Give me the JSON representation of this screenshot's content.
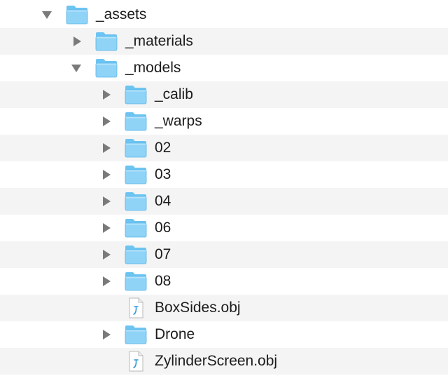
{
  "tree": {
    "items": [
      {
        "label": "_assets",
        "type": "folder",
        "state": "expanded",
        "depth": 0
      },
      {
        "label": "_materials",
        "type": "folder",
        "state": "collapsed",
        "depth": 1
      },
      {
        "label": "_models",
        "type": "folder",
        "state": "expanded",
        "depth": 1
      },
      {
        "label": "_calib",
        "type": "folder",
        "state": "collapsed",
        "depth": 2
      },
      {
        "label": "_warps",
        "type": "folder",
        "state": "collapsed",
        "depth": 2
      },
      {
        "label": "02",
        "type": "folder",
        "state": "collapsed",
        "depth": 2
      },
      {
        "label": "03",
        "type": "folder",
        "state": "collapsed",
        "depth": 2
      },
      {
        "label": "04",
        "type": "folder",
        "state": "collapsed",
        "depth": 2
      },
      {
        "label": "06",
        "type": "folder",
        "state": "collapsed",
        "depth": 2
      },
      {
        "label": "07",
        "type": "folder",
        "state": "collapsed",
        "depth": 2
      },
      {
        "label": "08",
        "type": "folder",
        "state": "collapsed",
        "depth": 2
      },
      {
        "label": "BoxSides.obj",
        "type": "file",
        "depth": 2
      },
      {
        "label": "Drone",
        "type": "folder",
        "state": "collapsed",
        "depth": 2
      },
      {
        "label": "ZylinderScreen.obj",
        "type": "file",
        "depth": 2
      }
    ]
  },
  "colors": {
    "folder_body": "#8fd3f7",
    "folder_tab": "#6cc4f2",
    "folder_edge": "#5bb5e6",
    "stripe": "#f4f4f4",
    "disclosure": "#7a7a7a",
    "text": "#1c1c1c"
  },
  "icons": {
    "folder": "folder-icon",
    "file": "obj-file-icon",
    "collapsed": "disclosure-triangle-right-icon",
    "expanded": "disclosure-triangle-down-icon"
  }
}
